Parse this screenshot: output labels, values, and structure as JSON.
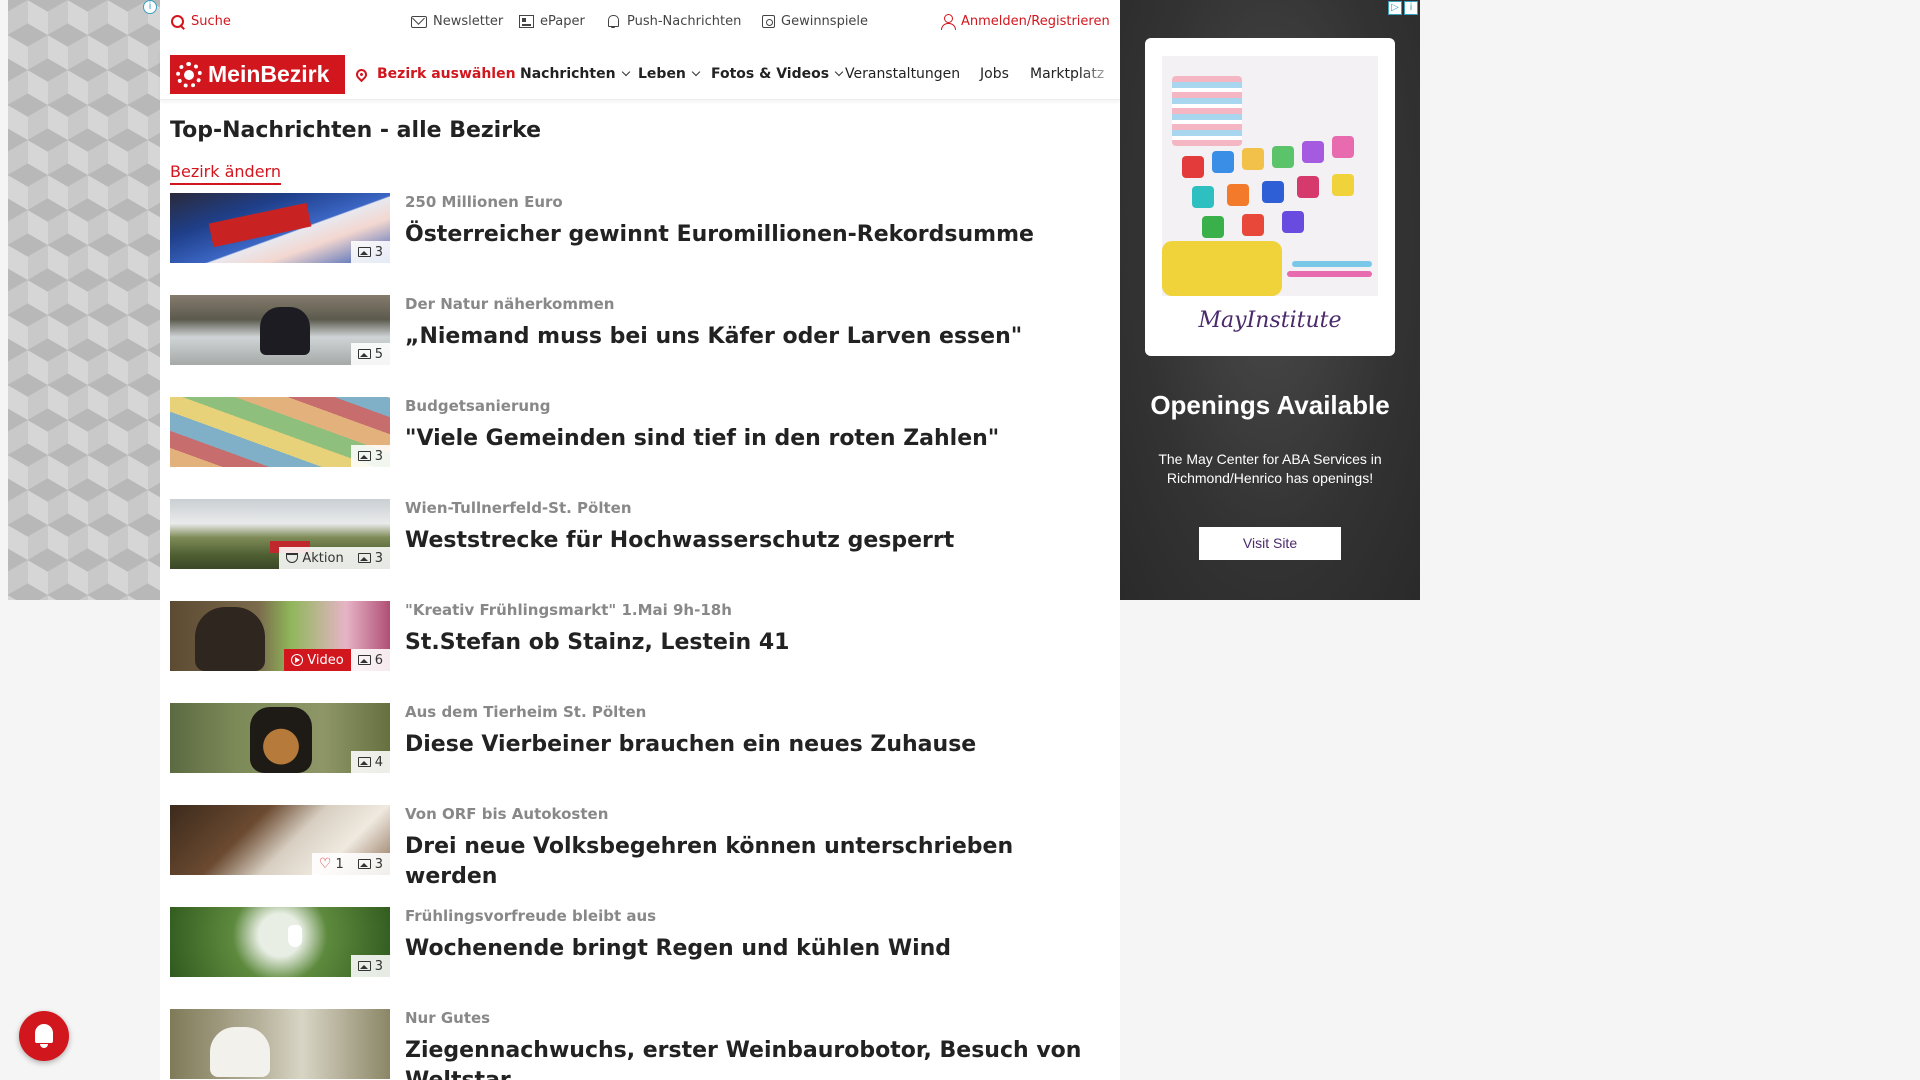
{
  "topbar": {
    "search": "Suche",
    "newsletter": "Newsletter",
    "epaper": "ePaper",
    "push": "Push-Nachrichten",
    "games": "Gewinnspiele",
    "login": "Anmelden/Registrieren"
  },
  "nav": {
    "logo": "MeinBezirk",
    "district": "Bezirk auswählen",
    "items": [
      "Nachrichten",
      "Leben",
      "Fotos & Videos",
      "Veranstaltungen",
      "Jobs",
      "Marktplatz"
    ]
  },
  "page": {
    "title": "Top-Nachrichten - alle Bezirke",
    "change_district": "Bezirk ändern"
  },
  "articles": [
    {
      "kicker": "250 Millionen Euro",
      "headline": "Österreicher gewinnt Euromillionen-Rekordsumme",
      "photos": "3"
    },
    {
      "kicker": "Der Natur näherkommen",
      "headline": "„Niemand muss bei uns Käfer oder Larven essen\"",
      "photos": "5"
    },
    {
      "kicker": "Budgetsanierung",
      "headline": "\"Viele Gemeinden sind tief in den roten Zahlen\"",
      "photos": "3"
    },
    {
      "kicker": "Wien-Tullnerfeld-St. Pölten",
      "headline": "Weststrecke für Hochwasserschutz gesperrt",
      "photos": "3",
      "action": "Aktion"
    },
    {
      "kicker": "\"Kreativ Frühlingsmarkt\" 1.Mai 9h-18h",
      "headline": "St.Stefan ob Stainz, Lestein 41",
      "photos": "6",
      "video": "Video"
    },
    {
      "kicker": "Aus dem Tierheim St. Pölten",
      "headline": "Diese Vierbeiner brauchen ein neues Zuhause",
      "photos": "4"
    },
    {
      "kicker": "Von ORF bis Autokosten",
      "headline": "Drei neue Volksbegehren können unterschrieben werden",
      "photos": "3",
      "likes": "1"
    },
    {
      "kicker": "Frühlingsvorfreude bleibt aus",
      "headline": "Wochenende bringt Regen und kühlen Wind",
      "photos": "3"
    },
    {
      "kicker": "Nur Gutes",
      "headline": "Ziegennachwuchs, erster Weinbaurobotor, Besuch von Weltstar"
    }
  ],
  "ad": {
    "brand": "MayInstitute",
    "title": "Openings Available",
    "text": "The May Center for ABA Services in Richmond/Henrico has openings!",
    "button": "Visit Site"
  },
  "colors": {
    "accent": "#d2161e"
  }
}
